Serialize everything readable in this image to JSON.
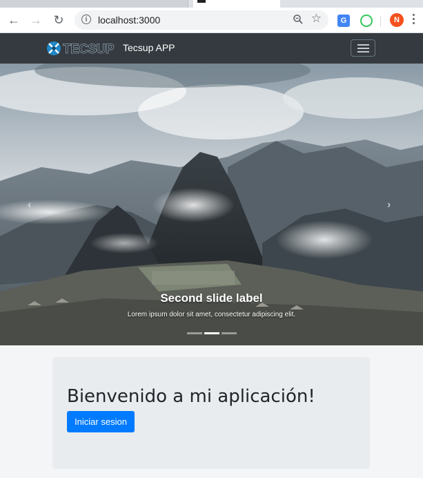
{
  "browser": {
    "url": "localhost:3000",
    "profile_initial": "N",
    "translate_label": "G"
  },
  "navbar": {
    "brand_logo_text": "TECSUP",
    "brand": "Tecsup APP"
  },
  "carousel": {
    "caption_title": "Second slide label",
    "caption_text": "Lorem ipsum dolor sit amet, consectetur adipiscing elit.",
    "slide_count": 3,
    "active_slide_index": 1
  },
  "jumbotron": {
    "heading": "Bienvenido a mi aplicación!",
    "button_label": "Iniciar sesion"
  },
  "colors": {
    "navbar_bg": "#343a40",
    "primary": "#007bff",
    "jumbotron_bg": "#e9ecef"
  }
}
